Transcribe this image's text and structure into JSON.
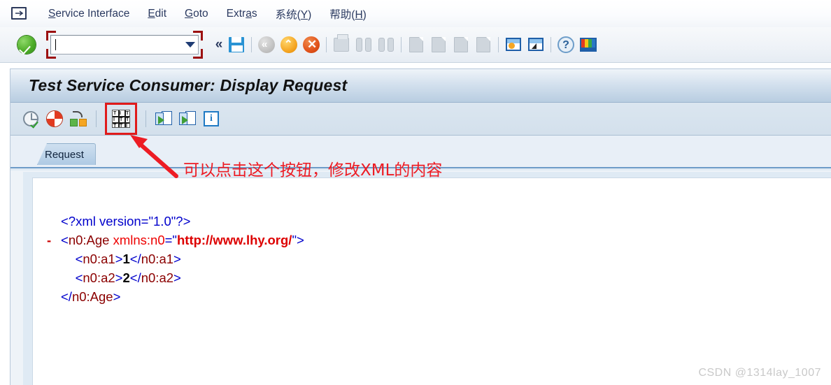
{
  "menu": {
    "logo_icon": "sap-logo-icon",
    "items": [
      {
        "label": "Service Interface",
        "accel": "S",
        "rest": "ervice Interface"
      },
      {
        "label": "Edit",
        "accel": "E",
        "rest": "dit"
      },
      {
        "label": "Goto",
        "accel": "G",
        "rest": "oto"
      },
      {
        "label": "Extras",
        "accel": "a",
        "pre": "Extr",
        "rest": "s"
      },
      {
        "label": "系统(Y)",
        "accel": "Y",
        "pre": "系统(",
        "rest": ")"
      },
      {
        "label": "帮助(H)",
        "accel": "H",
        "pre": "帮助(",
        "rest": ")"
      }
    ]
  },
  "toolbar": {
    "enter_tooltip": "Enter",
    "command_field": {
      "value": "",
      "placeholder": ""
    },
    "collapse_label": "«",
    "icons": [
      "save-icon",
      "back-icon",
      "exit-icon",
      "cancel-icon",
      "print-icon",
      "find-icon",
      "find-next-icon",
      "first-page-icon",
      "previous-page-icon",
      "next-page-icon",
      "last-page-icon",
      "new-window-icon",
      "create-session-icon",
      "help-icon",
      "customize-local-layout-icon"
    ]
  },
  "screen": {
    "title": "Test Service Consumer: Display Request"
  },
  "app_toolbar": {
    "buttons": [
      "execute-timer-icon",
      "status-pie-icon",
      "trace-config-icon",
      "xml-editor-grid-icon",
      "export-request-icon",
      "export-response-icon",
      "info-icon"
    ],
    "highlighted_button": "xml-editor-grid-icon"
  },
  "annotation": {
    "text": "可以点击这个按钮，修改XML的内容",
    "color": "#ed1c24",
    "arrow": "points from text to the highlighted XML editor button"
  },
  "tabs": [
    {
      "label": "Request",
      "selected": true
    }
  ],
  "xml_content": {
    "lines": [
      {
        "minus": "",
        "parts": [
          {
            "t": "<?xml version=\"1.0\"?>",
            "c": "b"
          }
        ],
        "indent": 0
      },
      {
        "minus": "-",
        "parts": [
          {
            "t": "<",
            "c": "b"
          },
          {
            "t": "n0:Age",
            "c": "tg"
          },
          {
            "t": " ",
            "c": "b"
          },
          {
            "t": "xmlns:n0",
            "c": "at"
          },
          {
            "t": "=\"",
            "c": "b"
          },
          {
            "t": "http://www.lhy.org/",
            "c": "vl"
          },
          {
            "t": "\">",
            "c": "b"
          }
        ],
        "indent": 0
      },
      {
        "minus": "",
        "parts": [
          {
            "t": "<",
            "c": "b"
          },
          {
            "t": "n0:a1",
            "c": "tg"
          },
          {
            "t": ">",
            "c": "b"
          },
          {
            "t": "1",
            "c": "tx"
          },
          {
            "t": "</",
            "c": "b"
          },
          {
            "t": "n0:a1",
            "c": "tg"
          },
          {
            "t": ">",
            "c": "b"
          }
        ],
        "indent": 1
      },
      {
        "minus": "",
        "parts": [
          {
            "t": "<",
            "c": "b"
          },
          {
            "t": "n0:a2",
            "c": "tg"
          },
          {
            "t": ">",
            "c": "b"
          },
          {
            "t": "2",
            "c": "tx"
          },
          {
            "t": "</",
            "c": "b"
          },
          {
            "t": "n0:a2",
            "c": "tg"
          },
          {
            "t": ">",
            "c": "b"
          }
        ],
        "indent": 1
      },
      {
        "minus": "",
        "parts": [
          {
            "t": "</",
            "c": "b"
          },
          {
            "t": "n0:Age",
            "c": "tg"
          },
          {
            "t": ">",
            "c": "b"
          }
        ],
        "indent": 0
      }
    ]
  },
  "watermark": "CSDN @1314lay_1007"
}
